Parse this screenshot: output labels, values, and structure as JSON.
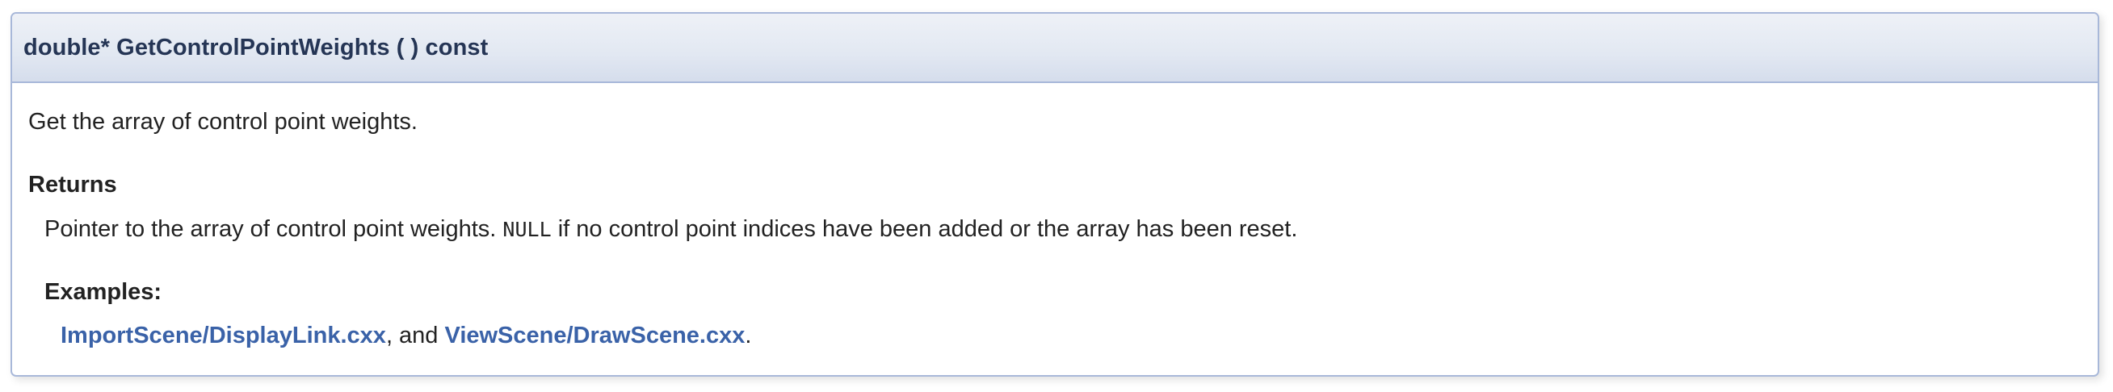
{
  "member": {
    "signature": "double* GetControlPointWeights ( ) const",
    "brief": "Get the array of control point weights.",
    "returns_label": "Returns",
    "returns_text_before": "Pointer to the array of control point weights.",
    "returns_code": "NULL",
    "returns_text_after": "if no control point indices have been added or the array has been reset.",
    "examples_label": "Examples:",
    "examples": [
      {
        "label": "ImportScene/DisplayLink.cxx"
      },
      {
        "label": "ViewScene/DrawScene.cxx"
      }
    ],
    "examples_separator": ", and ",
    "examples_end": "."
  },
  "colors": {
    "link": "#3a62a8",
    "border": "#a8b8d9",
    "header_bg": "#e2e8f2",
    "title_text": "#253555"
  }
}
